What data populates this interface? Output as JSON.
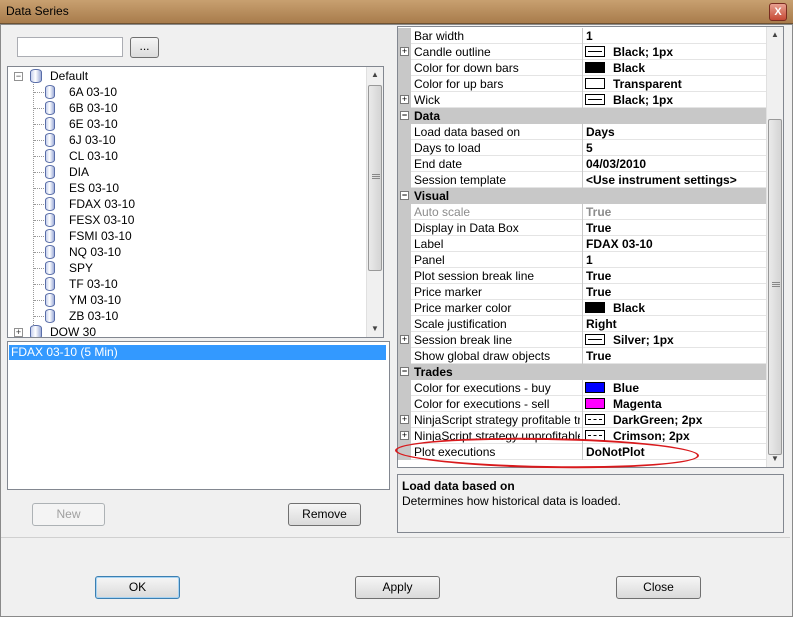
{
  "window": {
    "title": "Data Series",
    "close_glyph": "X"
  },
  "search": {
    "value": "",
    "browse_label": "..."
  },
  "tree": {
    "root": "Default",
    "items": [
      "6A 03-10",
      "6B 03-10",
      "6E 03-10",
      "6J 03-10",
      "CL 03-10",
      "DIA",
      "ES 03-10",
      "FDAX 03-10",
      "FESX 03-10",
      "FSMI 03-10",
      "NQ 03-10",
      "SPY",
      "TF 03-10",
      "YM 03-10",
      "ZB 03-10"
    ],
    "next_group": "DOW 30",
    "collapse_glyph": "−",
    "expand_glyph": "+"
  },
  "series_list": {
    "items": [
      "FDAX 03-10 (5 Min)"
    ]
  },
  "left_buttons": {
    "new": "New",
    "remove": "Remove"
  },
  "properties": {
    "rows": [
      {
        "name": "Bar width",
        "value": "1"
      },
      {
        "name": "Candle outline",
        "value": "Black; 1px"
      },
      {
        "name": "Color for down bars",
        "value": "Black"
      },
      {
        "name": "Color for up bars",
        "value": "Transparent"
      },
      {
        "name": "Wick",
        "value": "Black; 1px"
      },
      {
        "name": "Data"
      },
      {
        "name": "Load data based on",
        "value": "Days"
      },
      {
        "name": "Days to load",
        "value": "5"
      },
      {
        "name": "End date",
        "value": "04/03/2010"
      },
      {
        "name": "Session template",
        "value": "<Use instrument settings>"
      },
      {
        "name": "Visual"
      },
      {
        "name": "Auto scale",
        "value": "True"
      },
      {
        "name": "Display in Data Box",
        "value": "True"
      },
      {
        "name": "Label",
        "value": "FDAX 03-10"
      },
      {
        "name": "Panel",
        "value": "1"
      },
      {
        "name": "Plot session break line",
        "value": "True"
      },
      {
        "name": "Price marker",
        "value": "True"
      },
      {
        "name": "Price marker color",
        "value": "Black"
      },
      {
        "name": "Scale justification",
        "value": "Right"
      },
      {
        "name": "Session break line",
        "value": "Silver; 1px"
      },
      {
        "name": "Show global draw objects",
        "value": "True"
      },
      {
        "name": "Trades"
      },
      {
        "name": "Color for executions - buy",
        "value": "Blue"
      },
      {
        "name": "Color for executions - sell",
        "value": "Magenta"
      },
      {
        "name": "NinjaScript strategy profitable trac",
        "value": "DarkGreen; 2px"
      },
      {
        "name": "NinjaScript strategy unprofitable t",
        "value": "Crimson; 2px"
      },
      {
        "name": "Plot executions",
        "value": "DoNotPlot"
      }
    ],
    "colors": {
      "black": "#000000",
      "blue": "#0000ff",
      "magenta": "#ff00ff",
      "transparent": "#ffffff"
    },
    "group_glyph": "−",
    "sub_glyph": "+"
  },
  "description": {
    "title": "Load data based on",
    "text": "Determines how historical data is loaded."
  },
  "footer": {
    "ok": "OK",
    "apply": "Apply",
    "close": "Close"
  }
}
